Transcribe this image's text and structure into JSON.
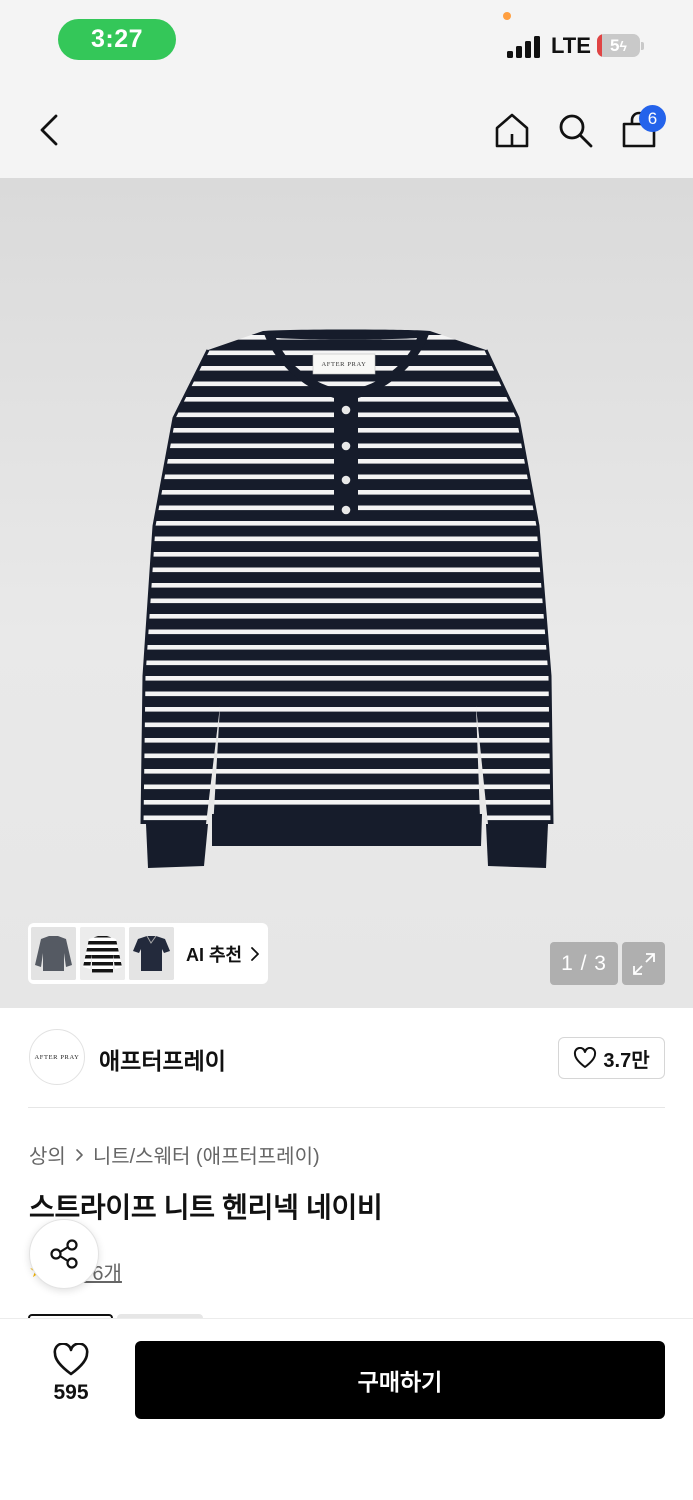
{
  "status_bar": {
    "time": "3:27",
    "network": "LTE",
    "battery": "5",
    "battery_charging_icon": "bolt-icon"
  },
  "top_nav": {
    "back_icon": "chevron-left-icon",
    "home_icon": "home-icon",
    "search_icon": "search-icon",
    "cart_icon": "shopping-bag-icon",
    "cart_count": "6"
  },
  "gallery": {
    "current_page": "1",
    "total_pages": "3",
    "page_indicator": "1 / 3",
    "ai_recommend_label": "AI 추천",
    "ai_thumbnails": [
      "gray-sweater",
      "striped-sweater",
      "navy-polo"
    ]
  },
  "brand": {
    "logo_text": "AFTER PRAY",
    "name": "애프터프레이",
    "like_count": "3.7만"
  },
  "breadcrumb": [
    "상의",
    "니트/스웨터 (애프터프레이)"
  ],
  "product": {
    "title": "스트라이프 니트 헨리넥 네이비",
    "review_link": "후기 6개"
  },
  "bottom_bar": {
    "like_count": "595",
    "buy_label": "구매하기"
  },
  "colors": {
    "time_pill": "#34c759",
    "cart_badge": "#2463eb",
    "buy_button": "#000000",
    "sweater_navy": "#161c2b"
  }
}
